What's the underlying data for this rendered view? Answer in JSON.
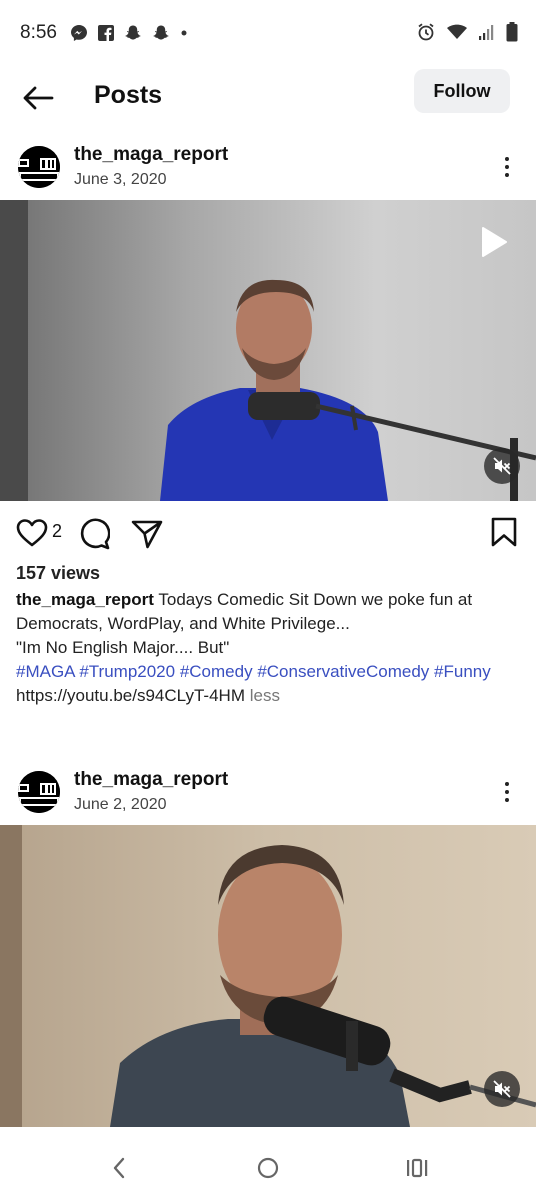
{
  "status_bar": {
    "time": "8:56"
  },
  "header": {
    "title": "Posts",
    "follow_label": "Follow"
  },
  "posts": [
    {
      "username": "the_maga_report",
      "date": "June 3, 2020",
      "likes": "2",
      "views": "157 views",
      "caption": {
        "username": "the_maga_report",
        "text": "Todays Comedic Sit Down we poke fun at Democrats, WordPlay, and White Privilege...",
        "quote": "\"Im No English Major.... But\"",
        "hashtags": [
          "#MAGA",
          "#Trump2020",
          "#Comedy",
          "#ConservativeComedy",
          "#Funny"
        ],
        "link": "https://youtu.be/s94CLyT-4HM",
        "less_label": "less"
      }
    },
    {
      "username": "the_maga_report",
      "date": "June 2, 2020"
    }
  ],
  "icons": {
    "status_left": [
      "messenger-icon",
      "facebook-icon",
      "snapchat-icon",
      "snapchat-icon",
      "dot-icon"
    ],
    "status_right": [
      "alarm-icon",
      "wifi-icon",
      "signal-icon",
      "battery-icon"
    ]
  },
  "colors": {
    "hashtag": "#3a4fc0",
    "follow_bg": "#eff0f2"
  }
}
